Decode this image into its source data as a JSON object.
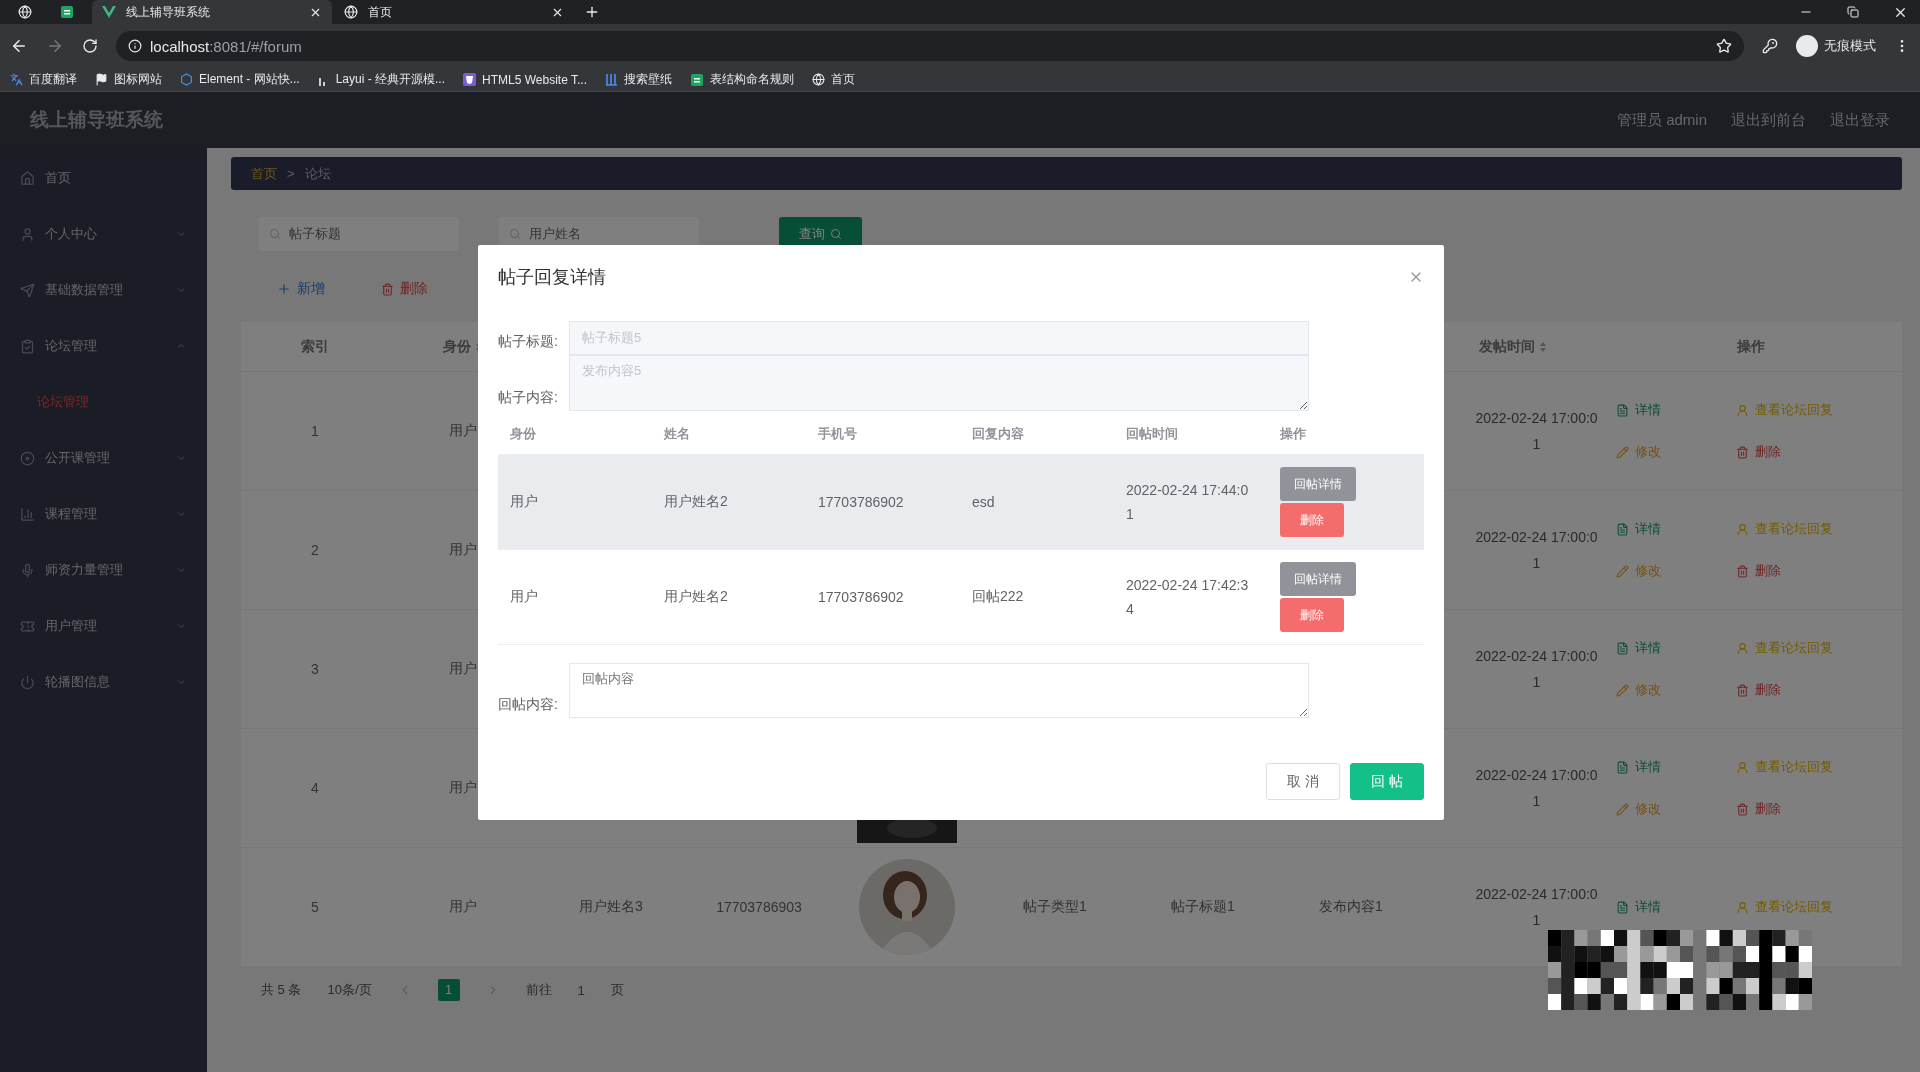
{
  "browser": {
    "tabs": [
      {
        "selected": false
      },
      {
        "selected": false
      },
      {
        "title": "线上辅导班系统",
        "selected": true
      },
      {
        "title": "首页",
        "selected": false
      }
    ],
    "address": {
      "host": "localhost",
      "path": ":8081/#/forum"
    },
    "profile": "无痕模式",
    "bookmarks": [
      "百度翻译",
      "图标网站",
      "Element - 网站快...",
      "Layui - 经典开源模...",
      "HTML5 Website T...",
      "搜索壁纸",
      "表结构命名规则",
      "首页"
    ]
  },
  "app": {
    "title": "线上辅导班系统",
    "user_links": [
      "管理员 admin",
      "退出到前台",
      "退出登录"
    ]
  },
  "sidebar": {
    "items": [
      {
        "label": "首页",
        "kind": "link"
      },
      {
        "label": "个人中心",
        "kind": "group",
        "expanded": false
      },
      {
        "label": "基础数据管理",
        "kind": "group",
        "expanded": false
      },
      {
        "label": "论坛管理",
        "kind": "group",
        "expanded": true,
        "children": [
          {
            "label": "论坛管理",
            "selected": true
          }
        ]
      },
      {
        "label": "公开课管理",
        "kind": "group",
        "expanded": false
      },
      {
        "label": "课程管理",
        "kind": "group",
        "expanded": false
      },
      {
        "label": "师资力量管理",
        "kind": "group",
        "expanded": false
      },
      {
        "label": "用户管理",
        "kind": "group",
        "expanded": false
      },
      {
        "label": "轮播图信息",
        "kind": "group",
        "expanded": false
      }
    ]
  },
  "breadcrumb": {
    "items": [
      "首页",
      "论坛"
    ],
    "separator": ">"
  },
  "search": {
    "fields": [
      {
        "placeholder": "帖子标题"
      },
      {
        "placeholder": "用户姓名"
      }
    ],
    "button": "查询"
  },
  "toolbar": [
    {
      "kind": "add",
      "label": "新增"
    },
    {
      "kind": "delete",
      "label": "删除"
    }
  ],
  "table": {
    "header": {
      "index": "索引",
      "identity": "身份",
      "time": "发帖时间",
      "actions": "操作"
    },
    "rows": [
      {
        "index": "1",
        "identity": "用户",
        "time": "2022-02-24 17:00:01",
        "actions": [
          {
            "kind": "detail",
            "label": "详情"
          },
          {
            "kind": "reply",
            "label": "查看论坛回复"
          },
          {
            "kind": "edit",
            "label": "修改"
          },
          {
            "kind": "delete",
            "label": "删除"
          }
        ]
      },
      {
        "index": "2",
        "identity": "用户",
        "time": "2022-02-24 17:00:01",
        "actions": [
          {
            "kind": "detail",
            "label": "详情"
          },
          {
            "kind": "reply",
            "label": "查看论坛回复"
          },
          {
            "kind": "edit",
            "label": "修改"
          },
          {
            "kind": "delete",
            "label": "删除"
          }
        ]
      },
      {
        "index": "3",
        "identity": "用户",
        "time": "2022-02-24 17:00:01",
        "actions": [
          {
            "kind": "detail",
            "label": "详情"
          },
          {
            "kind": "reply",
            "label": "查看论坛回复"
          },
          {
            "kind": "edit",
            "label": "修改"
          },
          {
            "kind": "delete",
            "label": "删除"
          }
        ]
      },
      {
        "index": "4",
        "identity": "用户",
        "photo": {
          "kind": "picture"
        },
        "time": "2022-02-24 17:00:01",
        "actions": [
          {
            "kind": "detail",
            "label": "详情"
          },
          {
            "kind": "reply",
            "label": "查看论坛回复"
          },
          {
            "kind": "edit",
            "label": "修改"
          },
          {
            "kind": "delete",
            "label": "删除"
          }
        ]
      },
      {
        "index": "5",
        "identity": "用户",
        "name": "用户姓名3",
        "phone": "17703786903",
        "photo": {
          "kind": "avatar"
        },
        "type": "帖子类型1",
        "title": "帖子标题1",
        "content": "发布内容1",
        "time": "2022-02-24 17:00:01",
        "actions": [
          {
            "kind": "detail",
            "label": "详情"
          },
          {
            "kind": "reply",
            "label": "查看论坛回复"
          }
        ]
      }
    ]
  },
  "pagination": {
    "total": "共 5 条",
    "page_size": "10条/页",
    "pages": [
      {
        "label": "1",
        "selected": true
      }
    ],
    "goto_label": "前往",
    "goto_value": "1",
    "goto_suffix": "页"
  },
  "modal": {
    "title": "帖子回复详情",
    "fields": [
      {
        "label": "帖子标题:",
        "kind": "input",
        "value": "帖子标题5"
      },
      {
        "label": "帖子内容:",
        "kind": "textarea",
        "value": "发布内容5"
      }
    ],
    "columns": [
      "身份",
      "姓名",
      "手机号",
      "回复内容",
      "回帖时间",
      "操作"
    ],
    "rows": [
      {
        "identity": "用户",
        "name": "用户姓名2",
        "phone": "17703786902",
        "content": "esd",
        "time": "2022-02-24 17:44:01",
        "hovered": true,
        "buttons": [
          {
            "kind": "detail",
            "label": "回帖详情"
          },
          {
            "kind": "delete",
            "label": "删除"
          }
        ]
      },
      {
        "identity": "用户",
        "name": "用户姓名2",
        "phone": "17703786902",
        "content": "回帖222",
        "time": "2022-02-24 17:42:34",
        "hovered": false,
        "buttons": [
          {
            "kind": "detail",
            "label": "回帖详情"
          },
          {
            "kind": "delete",
            "label": "删除"
          }
        ]
      }
    ],
    "reply": {
      "label": "回帖内容:",
      "placeholder": "回帖内容"
    },
    "buttons": [
      {
        "kind": "cancel",
        "label": "取 消"
      },
      {
        "kind": "primary",
        "label": "回 帖"
      }
    ]
  }
}
